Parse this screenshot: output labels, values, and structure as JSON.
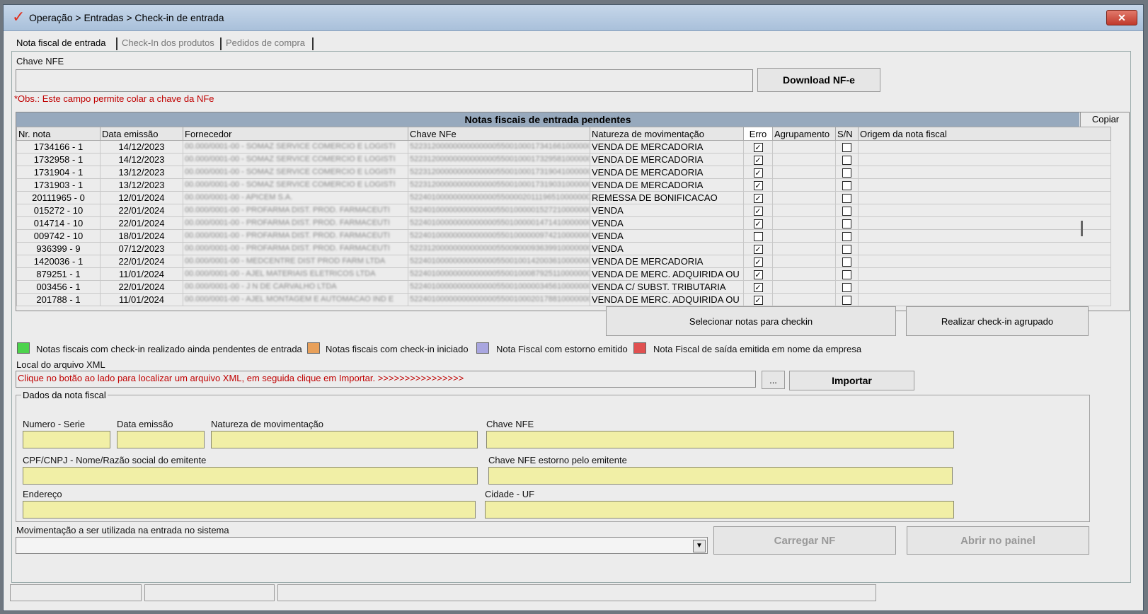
{
  "window": {
    "title": "Operação > Entradas > Check-in de entrada",
    "close_label": "✕"
  },
  "tabs": [
    {
      "label": "Nota fiscal de entrada",
      "active": true
    },
    {
      "label": "Check-In dos produtos",
      "active": false
    },
    {
      "label": "Pedidos de compra",
      "active": false
    }
  ],
  "chave_nfe": {
    "label": "Chave NFE",
    "value": "",
    "download_label": "Download NF-e",
    "obs": "*Obs.: Este campo permite colar a chave da NFe"
  },
  "grid": {
    "title": "Notas fiscais de entrada pendentes",
    "copy_label": "Copiar",
    "columns": [
      "Nr. nota",
      "Data emissão",
      "Fornecedor",
      "Chave NFe",
      "Natureza de movimentação",
      "Erro",
      "Agrupamento",
      "S/N",
      "Origem da nota fiscal"
    ],
    "rows": [
      {
        "nr": "1734166 - 1",
        "data": "14/12/2023",
        "fornecedor": "00.000/0001-00 - SOMAZ SERVICE COMERCIO E LOGISTI",
        "chave": "52231200000000000000550010001734166100000000",
        "natureza": "VENDA DE MERCADORIA",
        "erro": true,
        "sn": false
      },
      {
        "nr": "1732958 - 1",
        "data": "14/12/2023",
        "fornecedor": "00.000/0001-00 - SOMAZ SERVICE COMERCIO E LOGISTI",
        "chave": "52231200000000000000550010001732958100000000",
        "natureza": "VENDA DE MERCADORIA",
        "erro": true,
        "sn": false
      },
      {
        "nr": "1731904 - 1",
        "data": "13/12/2023",
        "fornecedor": "00.000/0001-00 - SOMAZ SERVICE COMERCIO E LOGISTI",
        "chave": "52231200000000000000550010001731904100000000",
        "natureza": "VENDA DE MERCADORIA",
        "erro": true,
        "sn": false
      },
      {
        "nr": "1731903 - 1",
        "data": "13/12/2023",
        "fornecedor": "00.000/0001-00 - SOMAZ SERVICE COMERCIO E LOGISTI",
        "chave": "52231200000000000000550010001731903100000000",
        "natureza": "VENDA DE MERCADORIA",
        "erro": true,
        "sn": false
      },
      {
        "nr": "20111965 - 0",
        "data": "12/01/2024",
        "fornecedor": "00.000/0001-00 - APICEM S.A.",
        "chave": "52240100000000000000550000201119651000000000",
        "natureza": "REMESSA DE BONIFICACAO",
        "erro": true,
        "sn": false
      },
      {
        "nr": "015272 - 10",
        "data": "22/01/2024",
        "fornecedor": "00.000/0001-00 - PROFARMA DIST. PROD. FARMACEUTI",
        "chave": "52240100000000000000550100000152721000000000",
        "natureza": "VENDA",
        "erro": true,
        "sn": false
      },
      {
        "nr": "014714 - 10",
        "data": "22/01/2024",
        "fornecedor": "00.000/0001-00 - PROFARMA DIST. PROD. FARMACEUTI",
        "chave": "52240100000000000000550100000147141000000000",
        "natureza": "VENDA",
        "erro": true,
        "sn": false
      },
      {
        "nr": "009742 - 10",
        "data": "18/01/2024",
        "fornecedor": "00.000/0001-00 - PROFARMA DIST. PROD. FARMACEUTI",
        "chave": "52240100000000000000550100000097421000000000",
        "natureza": "VENDA",
        "erro": false,
        "sn": false
      },
      {
        "nr": "936399 - 9",
        "data": "07/12/2023",
        "fornecedor": "00.000/0001-00 - PROFARMA DIST. PROD. FARMACEUTI",
        "chave": "52231200000000000000550090009363991000000000",
        "natureza": "VENDA",
        "erro": true,
        "sn": false
      },
      {
        "nr": "1420036 - 1",
        "data": "22/01/2024",
        "fornecedor": "00.000/0001-00 - MEDCENTRE DIST PROD FARM LTDA",
        "chave": "52240100000000000000550010014200361000000000",
        "natureza": "VENDA DE MERCADORIA",
        "erro": true,
        "sn": false
      },
      {
        "nr": "879251 - 1",
        "data": "11/01/2024",
        "fornecedor": "00.000/0001-00 - AJEL MATERIAIS ELETRICOS LTDA",
        "chave": "52240100000000000000550010008792511000000000",
        "natureza": "VENDA DE MERC. ADQUIRIDA OU",
        "erro": true,
        "sn": false
      },
      {
        "nr": "003456 - 1",
        "data": "22/01/2024",
        "fornecedor": "00.000/0001-00 - J N DE CARVALHO LTDA",
        "chave": "52240100000000000000550010000034561000000000",
        "natureza": "VENDA C/ SUBST. TRIBUTARIA",
        "erro": true,
        "sn": false
      },
      {
        "nr": "201788 - 1",
        "data": "11/01/2024",
        "fornecedor": "00.000/0001-00 - AJEL MONTAGEM E AUTOMACAO IND E",
        "chave": "52240100000000000000550010002017881000000000",
        "natureza": "VENDA DE MERC. ADQUIRIDA OU",
        "erro": true,
        "sn": false
      }
    ]
  },
  "actions": {
    "select_label": "Selecionar notas para checkin",
    "grouped_label": "Realizar check-in agrupado"
  },
  "legend": [
    {
      "label": "Notas fiscais com check-in realizado ainda pendentes de entrada",
      "color": "#4cd34c"
    },
    {
      "label": "Notas fiscais com check-in iniciado",
      "color": "#e8a05a"
    },
    {
      "label": "Nota Fiscal com estorno emitido",
      "color": "#a9a6e0"
    },
    {
      "label": "Nota Fiscal de saída emitida em nome da empresa",
      "color": "#e05050"
    }
  ],
  "xml": {
    "label": "Local do arquivo XML",
    "hint": "Clique no botão ao lado para localizar um arquivo XML, em seguida clique em Importar.   >>>>>>>>>>>>>>>>",
    "browse_label": "...",
    "import_label": "Importar"
  },
  "dados": {
    "group_title": "Dados da nota fiscal",
    "numero_serie_label": "Numero - Serie",
    "numero_serie_value": "",
    "data_emissao_label": "Data emissão",
    "data_emissao_value": "",
    "natureza_label": "Natureza de movimentação",
    "natureza_value": "",
    "chave_label": "Chave NFE",
    "chave_value": "",
    "cpf_label": "CPF/CNPJ - Nome/Razão social do emitente",
    "cpf_value": "",
    "chave_estorno_label": "Chave NFE estorno pelo emitente",
    "chave_estorno_value": "",
    "endereco_label": "Endereço",
    "endereco_value": "",
    "cidade_label": "Cidade - UF",
    "cidade_value": ""
  },
  "movimentacao": {
    "label": "Movimentação a ser utilizada na entrada no sistema",
    "value": "",
    "carregar_label": "Carregar NF",
    "abrir_label": "Abrir no painel"
  }
}
